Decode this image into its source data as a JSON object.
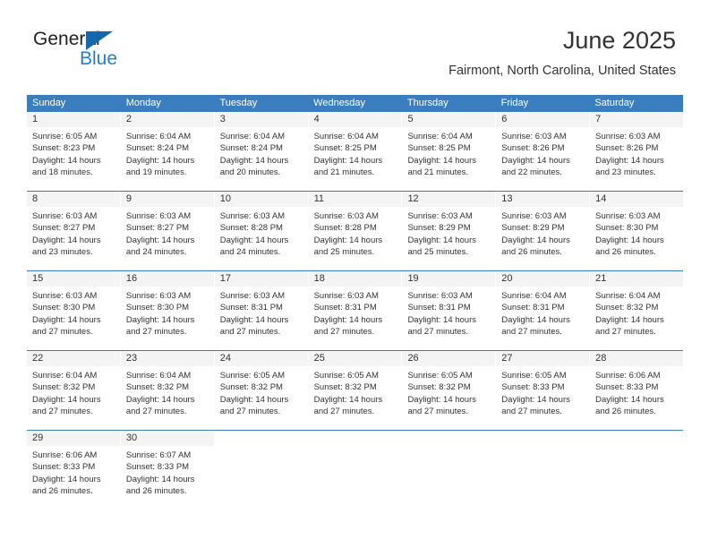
{
  "brand": {
    "name_top": "General",
    "name_bottom": "Blue",
    "flag_icon": "blue-triangle-flag-icon"
  },
  "header": {
    "month_title": "June 2025",
    "location": "Fairmont, North Carolina, United States"
  },
  "colors": {
    "header_blue": "#3a7ebf",
    "brand_blue": "#1f7fd0",
    "flag_blue": "#1767ad",
    "day_strip_gray": "#f4f4f4",
    "text": "#333333"
  },
  "weekdays": [
    "Sunday",
    "Monday",
    "Tuesday",
    "Wednesday",
    "Thursday",
    "Friday",
    "Saturday"
  ],
  "weeks": [
    [
      {
        "day": "1",
        "sunrise": "Sunrise: 6:05 AM",
        "sunset": "Sunset: 8:23 PM",
        "daylight1": "Daylight: 14 hours",
        "daylight2": "and 18 minutes."
      },
      {
        "day": "2",
        "sunrise": "Sunrise: 6:04 AM",
        "sunset": "Sunset: 8:24 PM",
        "daylight1": "Daylight: 14 hours",
        "daylight2": "and 19 minutes."
      },
      {
        "day": "3",
        "sunrise": "Sunrise: 6:04 AM",
        "sunset": "Sunset: 8:24 PM",
        "daylight1": "Daylight: 14 hours",
        "daylight2": "and 20 minutes."
      },
      {
        "day": "4",
        "sunrise": "Sunrise: 6:04 AM",
        "sunset": "Sunset: 8:25 PM",
        "daylight1": "Daylight: 14 hours",
        "daylight2": "and 21 minutes."
      },
      {
        "day": "5",
        "sunrise": "Sunrise: 6:04 AM",
        "sunset": "Sunset: 8:25 PM",
        "daylight1": "Daylight: 14 hours",
        "daylight2": "and 21 minutes."
      },
      {
        "day": "6",
        "sunrise": "Sunrise: 6:03 AM",
        "sunset": "Sunset: 8:26 PM",
        "daylight1": "Daylight: 14 hours",
        "daylight2": "and 22 minutes."
      },
      {
        "day": "7",
        "sunrise": "Sunrise: 6:03 AM",
        "sunset": "Sunset: 8:26 PM",
        "daylight1": "Daylight: 14 hours",
        "daylight2": "and 23 minutes."
      }
    ],
    [
      {
        "day": "8",
        "sunrise": "Sunrise: 6:03 AM",
        "sunset": "Sunset: 8:27 PM",
        "daylight1": "Daylight: 14 hours",
        "daylight2": "and 23 minutes."
      },
      {
        "day": "9",
        "sunrise": "Sunrise: 6:03 AM",
        "sunset": "Sunset: 8:27 PM",
        "daylight1": "Daylight: 14 hours",
        "daylight2": "and 24 minutes."
      },
      {
        "day": "10",
        "sunrise": "Sunrise: 6:03 AM",
        "sunset": "Sunset: 8:28 PM",
        "daylight1": "Daylight: 14 hours",
        "daylight2": "and 24 minutes."
      },
      {
        "day": "11",
        "sunrise": "Sunrise: 6:03 AM",
        "sunset": "Sunset: 8:28 PM",
        "daylight1": "Daylight: 14 hours",
        "daylight2": "and 25 minutes."
      },
      {
        "day": "12",
        "sunrise": "Sunrise: 6:03 AM",
        "sunset": "Sunset: 8:29 PM",
        "daylight1": "Daylight: 14 hours",
        "daylight2": "and 25 minutes."
      },
      {
        "day": "13",
        "sunrise": "Sunrise: 6:03 AM",
        "sunset": "Sunset: 8:29 PM",
        "daylight1": "Daylight: 14 hours",
        "daylight2": "and 26 minutes."
      },
      {
        "day": "14",
        "sunrise": "Sunrise: 6:03 AM",
        "sunset": "Sunset: 8:30 PM",
        "daylight1": "Daylight: 14 hours",
        "daylight2": "and 26 minutes."
      }
    ],
    [
      {
        "day": "15",
        "sunrise": "Sunrise: 6:03 AM",
        "sunset": "Sunset: 8:30 PM",
        "daylight1": "Daylight: 14 hours",
        "daylight2": "and 27 minutes."
      },
      {
        "day": "16",
        "sunrise": "Sunrise: 6:03 AM",
        "sunset": "Sunset: 8:30 PM",
        "daylight1": "Daylight: 14 hours",
        "daylight2": "and 27 minutes."
      },
      {
        "day": "17",
        "sunrise": "Sunrise: 6:03 AM",
        "sunset": "Sunset: 8:31 PM",
        "daylight1": "Daylight: 14 hours",
        "daylight2": "and 27 minutes."
      },
      {
        "day": "18",
        "sunrise": "Sunrise: 6:03 AM",
        "sunset": "Sunset: 8:31 PM",
        "daylight1": "Daylight: 14 hours",
        "daylight2": "and 27 minutes."
      },
      {
        "day": "19",
        "sunrise": "Sunrise: 6:03 AM",
        "sunset": "Sunset: 8:31 PM",
        "daylight1": "Daylight: 14 hours",
        "daylight2": "and 27 minutes."
      },
      {
        "day": "20",
        "sunrise": "Sunrise: 6:04 AM",
        "sunset": "Sunset: 8:31 PM",
        "daylight1": "Daylight: 14 hours",
        "daylight2": "and 27 minutes."
      },
      {
        "day": "21",
        "sunrise": "Sunrise: 6:04 AM",
        "sunset": "Sunset: 8:32 PM",
        "daylight1": "Daylight: 14 hours",
        "daylight2": "and 27 minutes."
      }
    ],
    [
      {
        "day": "22",
        "sunrise": "Sunrise: 6:04 AM",
        "sunset": "Sunset: 8:32 PM",
        "daylight1": "Daylight: 14 hours",
        "daylight2": "and 27 minutes."
      },
      {
        "day": "23",
        "sunrise": "Sunrise: 6:04 AM",
        "sunset": "Sunset: 8:32 PM",
        "daylight1": "Daylight: 14 hours",
        "daylight2": "and 27 minutes."
      },
      {
        "day": "24",
        "sunrise": "Sunrise: 6:05 AM",
        "sunset": "Sunset: 8:32 PM",
        "daylight1": "Daylight: 14 hours",
        "daylight2": "and 27 minutes."
      },
      {
        "day": "25",
        "sunrise": "Sunrise: 6:05 AM",
        "sunset": "Sunset: 8:32 PM",
        "daylight1": "Daylight: 14 hours",
        "daylight2": "and 27 minutes."
      },
      {
        "day": "26",
        "sunrise": "Sunrise: 6:05 AM",
        "sunset": "Sunset: 8:32 PM",
        "daylight1": "Daylight: 14 hours",
        "daylight2": "and 27 minutes."
      },
      {
        "day": "27",
        "sunrise": "Sunrise: 6:05 AM",
        "sunset": "Sunset: 8:33 PM",
        "daylight1": "Daylight: 14 hours",
        "daylight2": "and 27 minutes."
      },
      {
        "day": "28",
        "sunrise": "Sunrise: 6:06 AM",
        "sunset": "Sunset: 8:33 PM",
        "daylight1": "Daylight: 14 hours",
        "daylight2": "and 26 minutes."
      }
    ],
    [
      {
        "day": "29",
        "sunrise": "Sunrise: 6:06 AM",
        "sunset": "Sunset: 8:33 PM",
        "daylight1": "Daylight: 14 hours",
        "daylight2": "and 26 minutes."
      },
      {
        "day": "30",
        "sunrise": "Sunrise: 6:07 AM",
        "sunset": "Sunset: 8:33 PM",
        "daylight1": "Daylight: 14 hours",
        "daylight2": "and 26 minutes."
      },
      {
        "day": "",
        "sunrise": "",
        "sunset": "",
        "daylight1": "",
        "daylight2": ""
      },
      {
        "day": "",
        "sunrise": "",
        "sunset": "",
        "daylight1": "",
        "daylight2": ""
      },
      {
        "day": "",
        "sunrise": "",
        "sunset": "",
        "daylight1": "",
        "daylight2": ""
      },
      {
        "day": "",
        "sunrise": "",
        "sunset": "",
        "daylight1": "",
        "daylight2": ""
      },
      {
        "day": "",
        "sunrise": "",
        "sunset": "",
        "daylight1": "",
        "daylight2": ""
      }
    ]
  ]
}
